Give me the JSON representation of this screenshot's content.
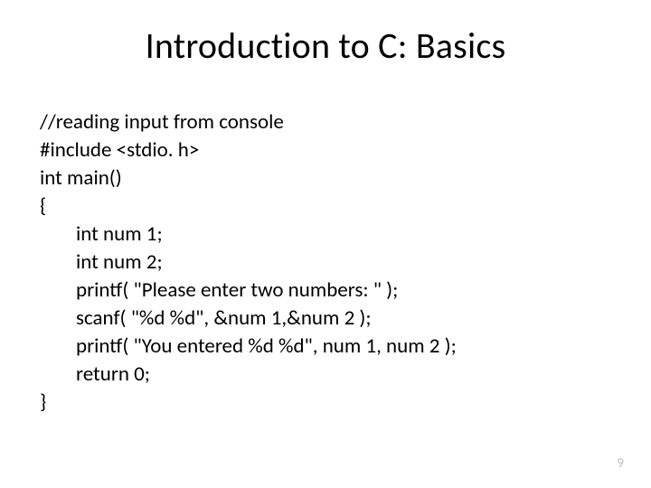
{
  "title": "Introduction to C: Basics",
  "code": {
    "l0": "//reading input from console",
    "l1": "#include <stdio. h>",
    "l2": "int main()",
    "l3": "{",
    "l4": "int num 1;",
    "l5": "int num 2;",
    "l6": "printf( \"Please enter two numbers: \" );",
    "l7": "scanf( \"%d %d\", &num 1,&num 2 );",
    "l8": "printf( \"You entered %d %d\", num 1, num 2 );",
    "l9": "return 0;",
    "l10": "}"
  },
  "page_number": "9"
}
